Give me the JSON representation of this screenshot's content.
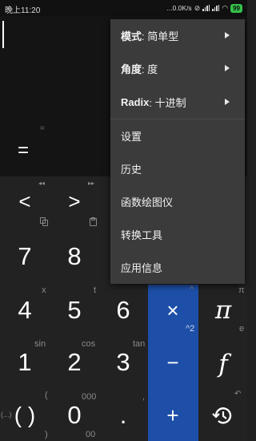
{
  "status": {
    "time": "晚上11:20",
    "network_speed": "...0.0K/s",
    "battery": "99"
  },
  "display": {
    "small_equals": "=",
    "result_equals": "="
  },
  "keypad": {
    "nav": {
      "rewind_hint": "◂◂",
      "forward_hint": "▸▸",
      "left": "<",
      "right": ">"
    },
    "digits": {
      "d7": "7",
      "d8": "8",
      "d4": "4",
      "d5": "5",
      "d6": "6",
      "d1": "1",
      "d2": "2",
      "d3": "3",
      "d0": "0",
      "dot": ".",
      "paren": "( )"
    },
    "ops": {
      "multiply": "×",
      "minus": "−",
      "plus": "+",
      "pi": "π",
      "function": "f"
    },
    "hints": {
      "x": "x",
      "t": "t",
      "caret": "^",
      "pi_small": "π",
      "e": "e",
      "pow2": "^2",
      "sin": "sin",
      "cos": "cos",
      "tan": "tan",
      "open_paren": "(",
      "close_paren": ")",
      "thousand": "000",
      "hundred": "00",
      "comma": ",",
      "ellipsis_paren": "(...)"
    },
    "colors": {
      "operator_column": "#1d4fa8",
      "display_bg": "#141414",
      "keypad_bg": "#222222"
    }
  },
  "menu": {
    "mode_key": "模式",
    "mode_value": ": 简单型",
    "angle_key": "角度",
    "angle_value": ": 度",
    "radix_key": "Radix",
    "radix_value": ": 十进制",
    "settings": "设置",
    "history": "历史",
    "plotter": "函数绘图仪",
    "converter": "转换工具",
    "app_info": "应用信息"
  }
}
